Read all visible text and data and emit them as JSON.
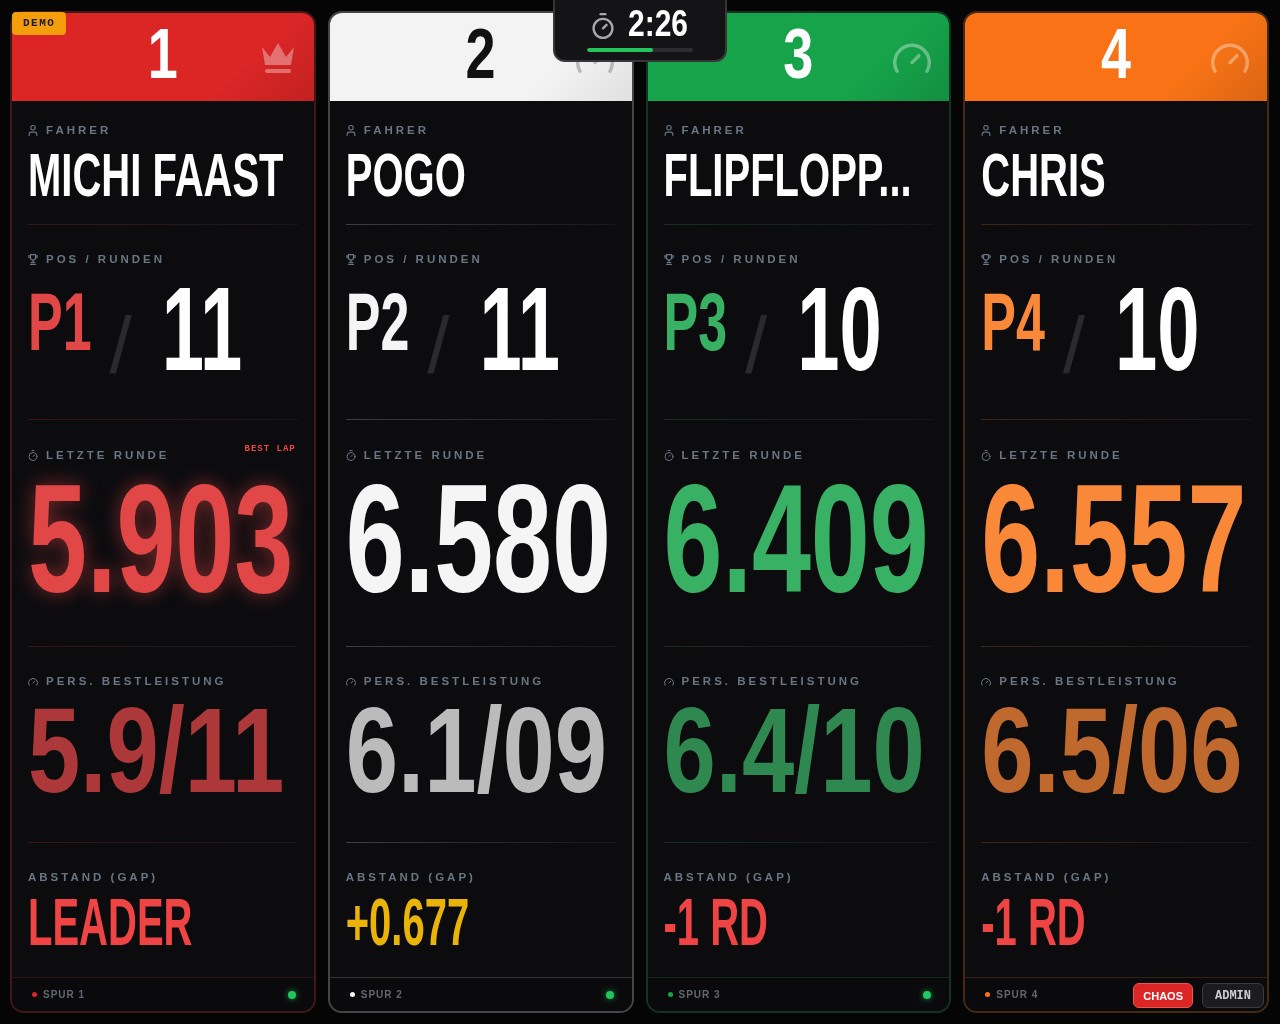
{
  "demo_badge": "DEMO",
  "timer": {
    "time": "2:26",
    "level": 0.62
  },
  "lanes": [
    {
      "number": "1",
      "color": "#dc2626",
      "kind": "leader",
      "driver": {
        "label": "FAHRER",
        "name": "MICHI FAAST"
      },
      "standing": {
        "label": "POS / RUNDEN",
        "position": "P1",
        "separator": "/",
        "laps": "11"
      },
      "last_lap": {
        "label": "LETZTE RUNDE",
        "time": "5.903",
        "best": true,
        "badge": "BEST LAP"
      },
      "personal_best": {
        "label": "PERS. BESTLEISTUNG",
        "value": "5.9/11"
      },
      "gap": {
        "label": "ABSTAND (GAP)",
        "value": "LEADER",
        "kind": "leader"
      },
      "footer": {
        "lane": "SPUR 1",
        "connected": true
      }
    },
    {
      "number": "2",
      "color": "#f3f3f3",
      "kind": "racer",
      "driver": {
        "label": "FAHRER",
        "name": "POGO"
      },
      "standing": {
        "label": "POS / RUNDEN",
        "position": "P2",
        "separator": "/",
        "laps": "11"
      },
      "last_lap": {
        "label": "LETZTE RUNDE",
        "time": "6.580",
        "best": false
      },
      "personal_best": {
        "label": "PERS. BESTLEISTUNG",
        "value": "6.1/09"
      },
      "gap": {
        "label": "ABSTAND (GAP)",
        "value": "+0.677",
        "kind": "behind"
      },
      "footer": {
        "lane": "SPUR 2",
        "connected": true
      }
    },
    {
      "number": "3",
      "color": "#16a34a",
      "kind": "racer",
      "driver": {
        "label": "FAHRER",
        "name": "FLIPFLOPP..."
      },
      "standing": {
        "label": "POS / RUNDEN",
        "position": "P3",
        "separator": "/",
        "laps": "10"
      },
      "last_lap": {
        "label": "LETZTE RUNDE",
        "time": "6.409",
        "best": false
      },
      "personal_best": {
        "label": "PERS. BESTLEISTUNG",
        "value": "6.4/10"
      },
      "gap": {
        "label": "ABSTAND (GAP)",
        "value": "-1 RD",
        "kind": "lapped"
      },
      "footer": {
        "lane": "SPUR 3",
        "connected": true
      }
    },
    {
      "number": "4",
      "color": "#f97316",
      "kind": "racer",
      "driver": {
        "label": "FAHRER",
        "name": "CHRIS"
      },
      "standing": {
        "label": "POS / RUNDEN",
        "position": "P4",
        "separator": "/",
        "laps": "10"
      },
      "last_lap": {
        "label": "LETZTE RUNDE",
        "time": "6.557",
        "best": false
      },
      "personal_best": {
        "label": "PERS. BESTLEISTUNG",
        "value": "6.5/06"
      },
      "gap": {
        "label": "ABSTAND (GAP)",
        "value": "-1 RD",
        "kind": "lapped"
      },
      "footer": {
        "lane": "SPUR 4"
      }
    }
  ],
  "controls": [
    {
      "label": "CHAOS",
      "kind": "danger"
    },
    {
      "label": "ADMIN",
      "kind": "neutral"
    }
  ]
}
